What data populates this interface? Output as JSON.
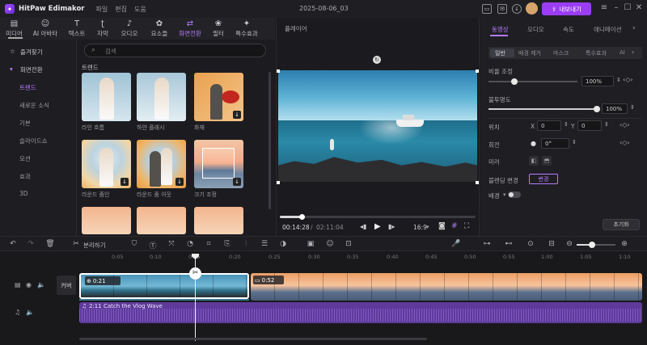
{
  "app": {
    "name": "HitPaw Edimakor",
    "menus": [
      "파일",
      "편집",
      "도움"
    ],
    "project_title": "2025-08-06_03",
    "export_label": "내보내기"
  },
  "toolbar": [
    {
      "label": "미디어",
      "icon": "folder-icon"
    },
    {
      "label": "AI 아바타",
      "icon": "avatar-icon"
    },
    {
      "label": "텍스트",
      "icon": "text-icon"
    },
    {
      "label": "자막",
      "icon": "subtitle-icon"
    },
    {
      "label": "오디오",
      "icon": "music-icon"
    },
    {
      "label": "요소들",
      "icon": "elements-icon"
    },
    {
      "label": "화면전환",
      "icon": "transition-icon",
      "active": true
    },
    {
      "label": "필터",
      "icon": "filter-icon"
    },
    {
      "label": "특수효과",
      "icon": "effects-icon"
    }
  ],
  "left_panel": {
    "favorites": "즐겨찾기",
    "section": "화면전환",
    "items": [
      "트렌드",
      "새로운 소식",
      "기본",
      "슬라이드쇼",
      "모션",
      "효과",
      "3D"
    ]
  },
  "media": {
    "search_placeholder": "검색",
    "category": "트렌드",
    "thumbs": [
      {
        "label": "라인 흐름"
      },
      {
        "label": "하얀 플래시"
      },
      {
        "label": "화재"
      },
      {
        "label": "라운드 줌인"
      },
      {
        "label": "라운드 줌 아웃"
      },
      {
        "label": "크기 조정"
      },
      {
        "label": ""
      },
      {
        "label": ""
      },
      {
        "label": ""
      }
    ]
  },
  "player": {
    "title": "플레이어",
    "current_time": "00:14:28",
    "total_time": "02:11:04",
    "aspect": "16:9",
    "progress": 0.11
  },
  "right_panel": {
    "tabs": [
      "동영상",
      "오디오",
      "속도",
      "애니메이션"
    ],
    "subtabs": [
      "일반",
      "배경 제거",
      "마스크",
      "특수효과",
      "AI"
    ],
    "scale_label": "비율 조정",
    "scale_value": "100%",
    "opacity_label": "불투명도",
    "opacity_value": "100%",
    "position_label": "위치",
    "pos_x_label": "X",
    "pos_x": "0",
    "pos_y_label": "Y",
    "pos_y": "0",
    "rotate_label": "회전",
    "rotate_value": "0°",
    "mirror_label": "미러",
    "blend_label": "블렌딩 변경",
    "blend_value": "변경",
    "bg_label": "배경",
    "reset_label": "초기화"
  },
  "timeline": {
    "split_label": "분리하기",
    "ruler": [
      "0:05",
      "0:10",
      "0:15",
      "0:20",
      "0:25",
      "0:30",
      "0:35",
      "0:40",
      "0:45",
      "0:50",
      "0:55",
      "1:00",
      "1:05",
      "1:10"
    ],
    "cover_label": "커버",
    "clip1_duration": "0:21",
    "clip2_duration": "0:52",
    "audio_label": "2:11 Catch the Vlog Wave"
  },
  "colors": {
    "accent": "#9b3df5",
    "accent_light": "#b57bff",
    "audio_track": "#5e3a9a",
    "clip_selected": "#ffffff"
  }
}
